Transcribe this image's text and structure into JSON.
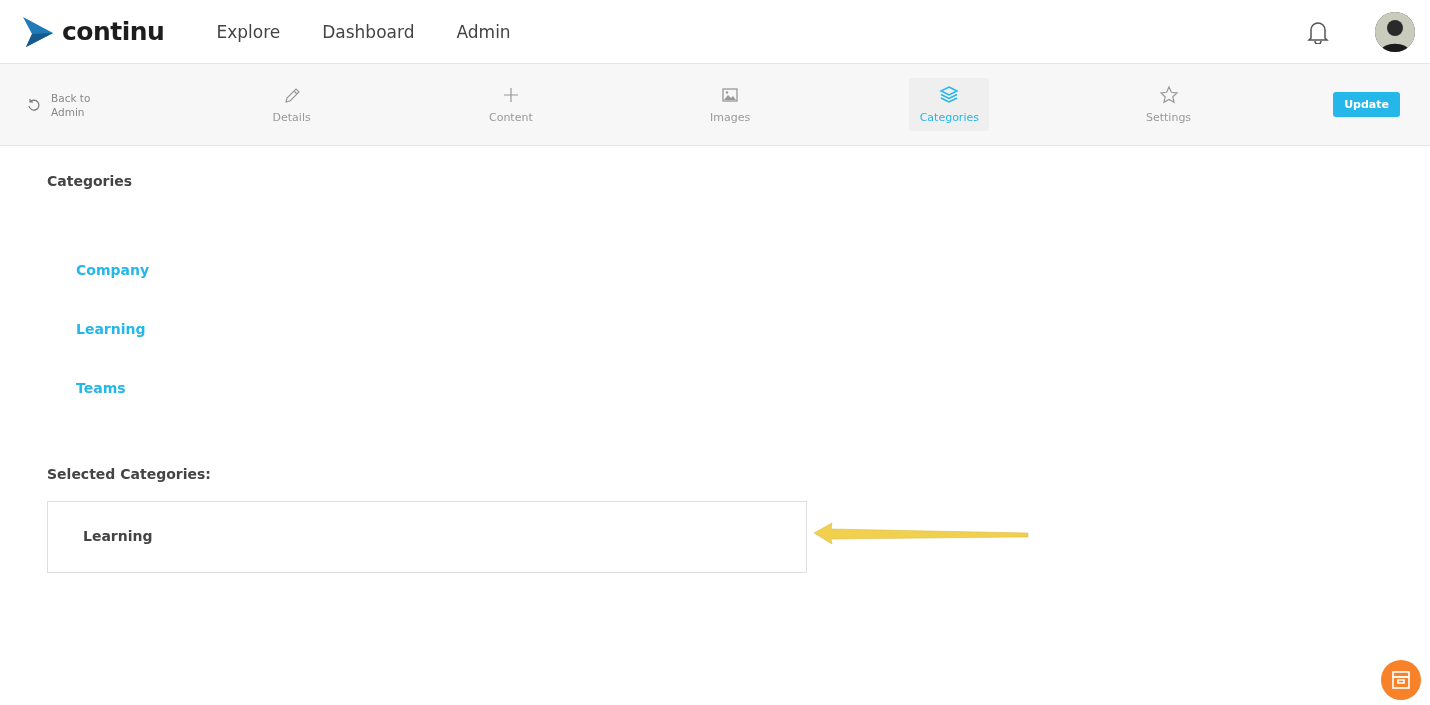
{
  "header": {
    "logo": "continu",
    "nav": [
      {
        "label": "Explore"
      },
      {
        "label": "Dashboard"
      },
      {
        "label": "Admin"
      }
    ]
  },
  "toolbar": {
    "back": "Back to Admin",
    "tabs": [
      {
        "label": "Details",
        "kind": "pencil",
        "selected": false
      },
      {
        "label": "Content",
        "kind": "plus",
        "selected": false
      },
      {
        "label": "Images",
        "kind": "image",
        "selected": false
      },
      {
        "label": "Categories",
        "kind": "layers",
        "selected": true
      },
      {
        "label": "Settings",
        "kind": "star",
        "selected": false
      }
    ],
    "button": "Update"
  },
  "categories": {
    "title": "Categories",
    "items": [
      {
        "label": "Company"
      },
      {
        "label": "Learning"
      },
      {
        "label": "Teams"
      }
    ],
    "selected_title": "Selected Categories:",
    "selected": [
      {
        "label": "Learning"
      }
    ]
  }
}
